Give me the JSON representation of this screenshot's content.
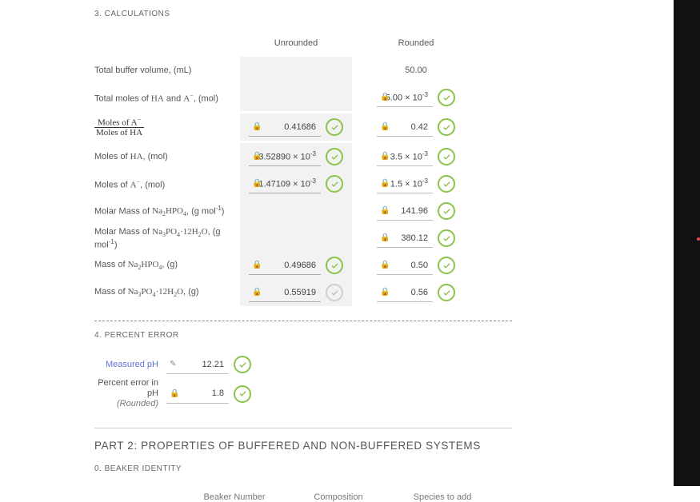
{
  "sections": {
    "calc_title": "3. CALCULATIONS",
    "percent_title": "4. PERCENT ERROR",
    "part2_title": "PART 2: PROPERTIES OF BUFFERED AND NON-BUFFERED SYSTEMS",
    "beaker_title": "0. BEAKER IDENTITY"
  },
  "headers": {
    "unrounded": "Unrounded",
    "rounded": "Rounded",
    "beaker_num": "Beaker Number",
    "composition": "Composition",
    "species": "Species to add"
  },
  "rows": {
    "total_volume": {
      "label": "Total buffer volume, (mL)",
      "rounded_plain": "50.00"
    },
    "total_moles": {
      "label_pre": "Total moles of ",
      "ha": "HA",
      "and": " and ",
      "am": "A",
      "am_sup": "−",
      "label_post": ", (mol)",
      "rounded": "5.00 × 10",
      "rounded_sup": "-3"
    },
    "ratio": {
      "num_pre": "Moles of ",
      "num_a": "A",
      "num_sup": "−",
      "den_pre": "Moles of ",
      "den_ha": "HA",
      "unrounded": "0.41686",
      "rounded": "0.42"
    },
    "moles_ha": {
      "label_pre": "Moles of ",
      "ha": "HA",
      "label_post": ", (mol)",
      "unrounded": "3.52890 × 10",
      "un_sup": "-3",
      "rounded": "3.5 × 10",
      "r_sup": "-3"
    },
    "moles_am": {
      "label_pre": "Moles of ",
      "a": "A",
      "a_sup": "−",
      "label_post": ", (mol)",
      "unrounded": "1.47109 × 10",
      "un_sup": "-3",
      "rounded": "1.5 × 10",
      "r_sup": "-3"
    },
    "mm_na2": {
      "rounded": "141.96"
    },
    "mm_na3": {
      "rounded": "380.12"
    },
    "mass_na2": {
      "unrounded": "0.49686",
      "rounded": "0.50"
    },
    "mass_na3": {
      "unrounded": "0.55919",
      "rounded": "0.56"
    }
  },
  "percent": {
    "measured_label": "Measured pH",
    "measured_val": "12.21",
    "error_label": "Percent error in pH",
    "error_sub": "(Rounded)",
    "error_val": "1.8"
  }
}
